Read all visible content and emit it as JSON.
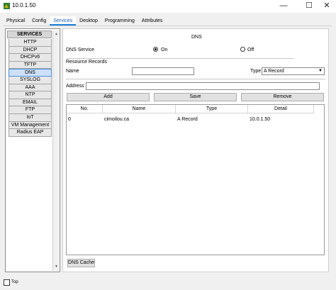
{
  "window": {
    "title": "10.0.1.50",
    "minimize": "—",
    "maximize": "☐",
    "close": "✕"
  },
  "tabs": [
    "Physical",
    "Config",
    "Services",
    "Desktop",
    "Programming",
    "Attributes"
  ],
  "active_tab": "Services",
  "services": {
    "header": "SERVICES",
    "items": [
      "HTTP",
      "DHCP",
      "DHCPv6",
      "TFTP",
      "DNS",
      "SYSLOG",
      "AAA",
      "NTP",
      "EMAIL",
      "FTP",
      "IoT",
      "VM Management",
      "Radius EAP"
    ],
    "selected": "DNS"
  },
  "dns": {
    "title": "DNS",
    "service_label": "DNS Service",
    "on_label": "On",
    "off_label": "Off",
    "service_state": "On",
    "resource_records_label": "Resource Records",
    "name_label": "Name",
    "name_value": "",
    "type_label": "Type",
    "type_value": "A Record",
    "address_label": "Address",
    "address_value": "",
    "add_button": "Add",
    "save_button": "Save",
    "remove_button": "Remove",
    "columns": [
      "No.",
      "Name",
      "Type",
      "Detail"
    ],
    "rows": [
      {
        "no": "0",
        "name": "cimoilou.ca",
        "type": "A Record",
        "detail": "10.0.1.50"
      }
    ],
    "cache_button": "DNS Cache"
  },
  "footer": {
    "top_label": "Top",
    "top_checked": false
  },
  "colors": {
    "accent": "#1a7fd6",
    "selected_item": "#cde0f7"
  }
}
